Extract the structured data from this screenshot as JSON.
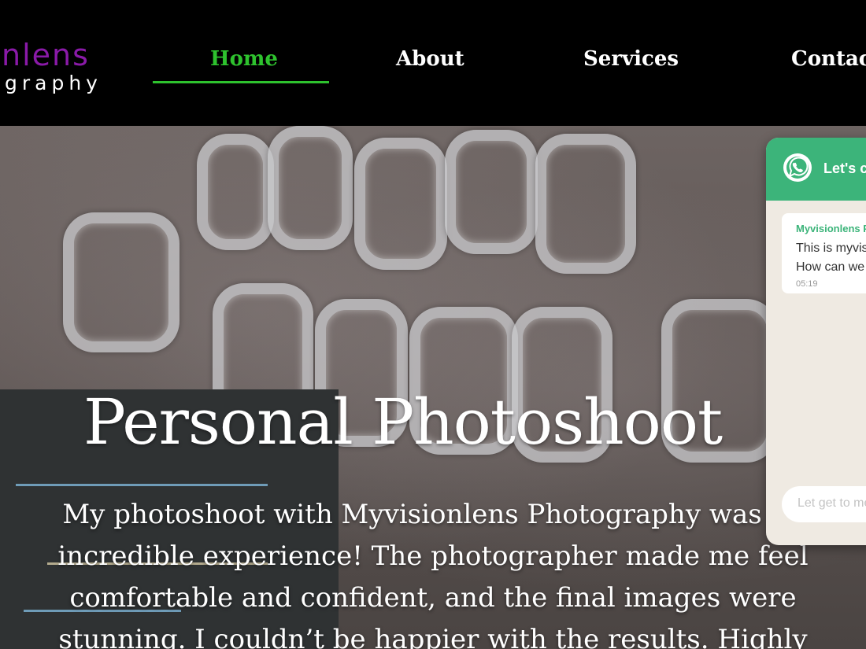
{
  "logo": {
    "main": "nlens",
    "sub": "graphy"
  },
  "nav": {
    "items": [
      {
        "label": "Home",
        "active": true
      },
      {
        "label": "About",
        "active": false
      },
      {
        "label": "Services",
        "active": false
      },
      {
        "label": "Contact",
        "active": false
      }
    ],
    "active_color": "#2ec22e"
  },
  "hero": {
    "title": "Personal Photoshoot",
    "text": "My photoshoot with Myvisionlens Photography was an incredible experience! The photographer made me feel comfortable and confident, and the final images were stunning. I couldn’t be happier with the results. Highly"
  },
  "whatsapp": {
    "icon": "whatsapp-icon",
    "title": "Let's chat",
    "sender": "Myvisionlens Photography",
    "message_line1": "This is myvisionlens",
    "message_line2": "How can we help?",
    "time": "05:19",
    "input_placeholder": "Let get to meet",
    "brand_color": "#3cb47a"
  }
}
